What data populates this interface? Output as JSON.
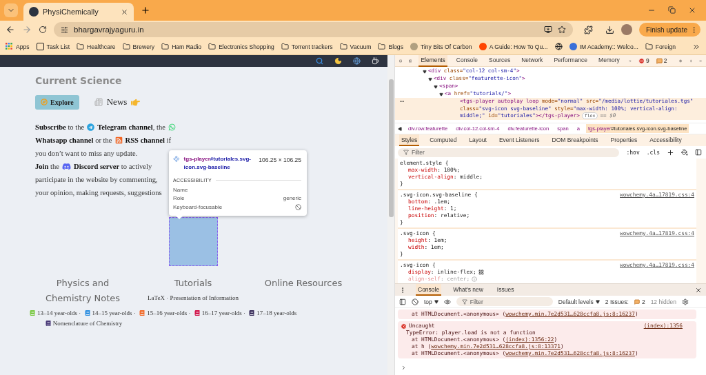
{
  "browser": {
    "tabs": [
      {
        "title": "PhysiChemically",
        "selected": true
      }
    ],
    "address": "bhargavrajyaguru.in",
    "update_button": "Finish update",
    "bookmarks": [
      {
        "kind": "apps",
        "label": "Apps"
      },
      {
        "kind": "page",
        "label": "Task List"
      },
      {
        "kind": "folder",
        "label": "Healthcare"
      },
      {
        "kind": "folder",
        "label": "Brewery"
      },
      {
        "kind": "folder",
        "label": "Ham Radio"
      },
      {
        "kind": "folder",
        "label": "Electronics Shopping"
      },
      {
        "kind": "folder",
        "label": "Torrent trackers"
      },
      {
        "kind": "folder",
        "label": "Vacuum"
      },
      {
        "kind": "folder",
        "label": "Blogs"
      },
      {
        "kind": "site",
        "label": "Tiny Bits Of Carbon",
        "color": "#b0a080"
      },
      {
        "kind": "site",
        "label": "A Guide: How To Qu...",
        "color": "#ff4500"
      },
      {
        "kind": "globe"
      },
      {
        "kind": "site",
        "label": "IM Academy:: Welco...",
        "color": "#3a6fd8"
      },
      {
        "kind": "folder",
        "label": "Foreign"
      }
    ]
  },
  "page": {
    "heading": "Current Science",
    "explore_button": "Explore",
    "news_link": "News",
    "lines": [
      [
        {
          "kind": "text",
          "text": "**Subscribe** to the"
        },
        {
          "kind": "telegram"
        },
        {
          "kind": "text",
          "text": "**Telegram channel**, the"
        },
        {
          "kind": "whatsapp"
        }
      ],
      [
        {
          "kind": "text",
          "text": "**Whatsapp channel** or the"
        },
        {
          "kind": "rss"
        },
        {
          "kind": "text",
          "text": "**RSS channel** if"
        }
      ],
      [
        {
          "kind": "text",
          "text": "you don’t want to miss any update."
        }
      ],
      [
        {
          "kind": "text",
          "text": "**Join** the"
        },
        {
          "kind": "discord"
        },
        {
          "kind": "text",
          "text": "**Discord server** to actively"
        }
      ],
      [
        {
          "kind": "text",
          "text": "participate in the website by commenting,"
        }
      ],
      [
        {
          "kind": "text",
          "text": "your opinion, making requests, suggestions"
        }
      ]
    ],
    "tooltip": {
      "tag": "tgs-player",
      "selector": "#tutoriales.svg-icon.svg-baseline",
      "size": "106.25 × 106.25",
      "section": "ACCESSIBILITY",
      "rows": [
        {
          "label": "Name"
        },
        {
          "label": "Role",
          "value": "generic"
        },
        {
          "label": "Keyboard-focusable",
          "focusable": false
        }
      ]
    },
    "columns": [
      {
        "title": "Physics and Chemistry Notes",
        "groups": [
          {
            "label": "13–14 year-olds",
            "color": "#7ac943",
            "separator": "·"
          },
          {
            "label": "14–15 year-olds",
            "color": "#2e8fe0",
            "separator": "·"
          },
          {
            "label": "15–16 year-olds",
            "color": "#f26b2a",
            "separator": "·"
          },
          {
            "label": "16–17 year-olds",
            "color": "#d3154b",
            "separator": "·"
          },
          {
            "label": "17–18 year-olds",
            "color": "#3b2f5c"
          }
        ],
        "extra": [
          {
            "label": "Nomenclature of Chemistry",
            "color": "#4a3a78"
          }
        ]
      },
      {
        "title": "Tutorials",
        "text": "LaTeX · Presentation of Information"
      },
      {
        "title": "Online Resources"
      }
    ]
  },
  "devtools": {
    "tabs": [
      {
        "label": "Elements",
        "selected": true
      },
      {
        "label": "Console",
        "selected": false
      },
      {
        "label": "Sources",
        "selected": false
      },
      {
        "label": "Network",
        "selected": false
      },
      {
        "label": "Performance",
        "selected": false
      },
      {
        "label": "Memory",
        "selected": false
      }
    ],
    "errors": "9",
    "issues": "2",
    "dom": [
      {
        "text": "<div class=\"col-12 col-sm-4\">",
        "expanded": true,
        "selected": false,
        "children": [
          {
            "text": "<div class=\"featurette-icon\">",
            "expanded": true,
            "selected": false,
            "children": [
              {
                "text": "<span>",
                "expanded": true,
                "selected": false,
                "children": [
                  {
                    "text": "<a href=\"tutorials/\">",
                    "expanded": true,
                    "selected": false,
                    "children": [
                      {
                        "text": "<tgs-player autoplay loop mode=\"normal\" src=\"/media/lottie/tutoriales.tgs\" class=\"svg-icon svg-baseline\" style=\"max-width: 100%; vertical-align: middle;\" id=\"tutoriales\"></tgs-player>",
                        "selected": true,
                        "badge": "flex",
                        "suffix": "== $0"
                      }
                    ]
                  }
                ]
              }
            ]
          }
        ]
      }
    ],
    "breadcrumbs": [
      {
        "tag": "div",
        "rest": ".row.featurette",
        "selected": false
      },
      {
        "tag": "div",
        "rest": ".col-12.col-sm-4",
        "selected": false
      },
      {
        "tag": "div",
        "rest": ".featurette-icon",
        "selected": false
      },
      {
        "tag": "span",
        "selected": false
      },
      {
        "tag": "a",
        "selected": false
      },
      {
        "tag": "tgs-player",
        "rest": "#tutoriales.svg-icon.svg-baseline",
        "selected": true
      }
    ],
    "subtabs": [
      {
        "label": "Styles",
        "selected": true
      },
      {
        "label": "Computed",
        "selected": false
      },
      {
        "label": "Layout",
        "selected": false
      },
      {
        "label": "Event Listeners",
        "selected": false
      },
      {
        "label": "DOM Breakpoints",
        "selected": false
      },
      {
        "label": "Properties",
        "selected": false
      },
      {
        "label": "Accessibility",
        "selected": false
      }
    ],
    "filter_placeholder": "Filter",
    "hov": ":hov",
    "cls": ".cls",
    "rules": [
      {
        "selector": "element.style {",
        "close": "}",
        "props": [
          {
            "kind": "plain",
            "text": "max-width: 100%;",
            "inactive": false
          },
          {
            "kind": "plain",
            "text": "vertical-align: middle;",
            "inactive": false
          }
        ]
      },
      {
        "selector": ".svg-icon.svg-baseline {",
        "source": "wowchemy.4a…17819.css:4",
        "close": "}",
        "props": [
          {
            "kind": "plain",
            "text": "bottom: .1em;",
            "inactive": false
          },
          {
            "kind": "plain",
            "text": "line-height: 1;",
            "inactive": false
          },
          {
            "kind": "plain",
            "text": "position: relative;",
            "inactive": false
          }
        ]
      },
      {
        "selector": ".svg-icon {",
        "source": "wowchemy.4a…17819.css:4",
        "close": "}",
        "props": [
          {
            "kind": "plain",
            "text": "height: 1em;",
            "inactive": false
          },
          {
            "kind": "plain",
            "text": "width: 1em;",
            "inactive": false
          }
        ]
      },
      {
        "selector": ".svg-icon {",
        "source": "wowchemy.4a…17819.css:4",
        "props": [
          {
            "kind": "grid",
            "text": "display: inline-flex;",
            "inactive": false
          },
          {
            "kind": "info",
            "text": "align-self: center;",
            "inactive": true
          }
        ]
      }
    ],
    "drawer_tabs": [
      {
        "label": "Console",
        "selected": true
      },
      {
        "label": "What's new",
        "selected": false
      },
      {
        "label": "Issues",
        "selected": false
      }
    ],
    "console": {
      "context": "top",
      "filter_placeholder": "Filter",
      "levels": "Default levels",
      "issues_label": "2 Issues:",
      "issues_count": "2",
      "hidden": "12 hidden",
      "messages": [
        {
          "stack": [
            {
              "text": "at HTMLDocument.<anonymous> (",
              "link": "wowchemy.min.7e2d531…628ccfa8.js:8:16237",
              "end": ")"
            }
          ]
        },
        {
          "title": "Uncaught",
          "source": "(index):1356",
          "message": "TypeError: player.load is not a function",
          "stack": [
            {
              "text": "at HTMLDocument.<anonymous> (",
              "link": "(index):1356:22",
              "end": ")"
            },
            {
              "text": "at h (",
              "link": "wowchemy.min.7e2d531…628ccfa8.js:8:13371",
              "end": ")"
            },
            {
              "text": "at HTMLDocument.<anonymous> (",
              "link": "wowchemy.min.7e2d531…628ccfa8.js:8:16237",
              "end": ")"
            }
          ]
        }
      ]
    }
  }
}
